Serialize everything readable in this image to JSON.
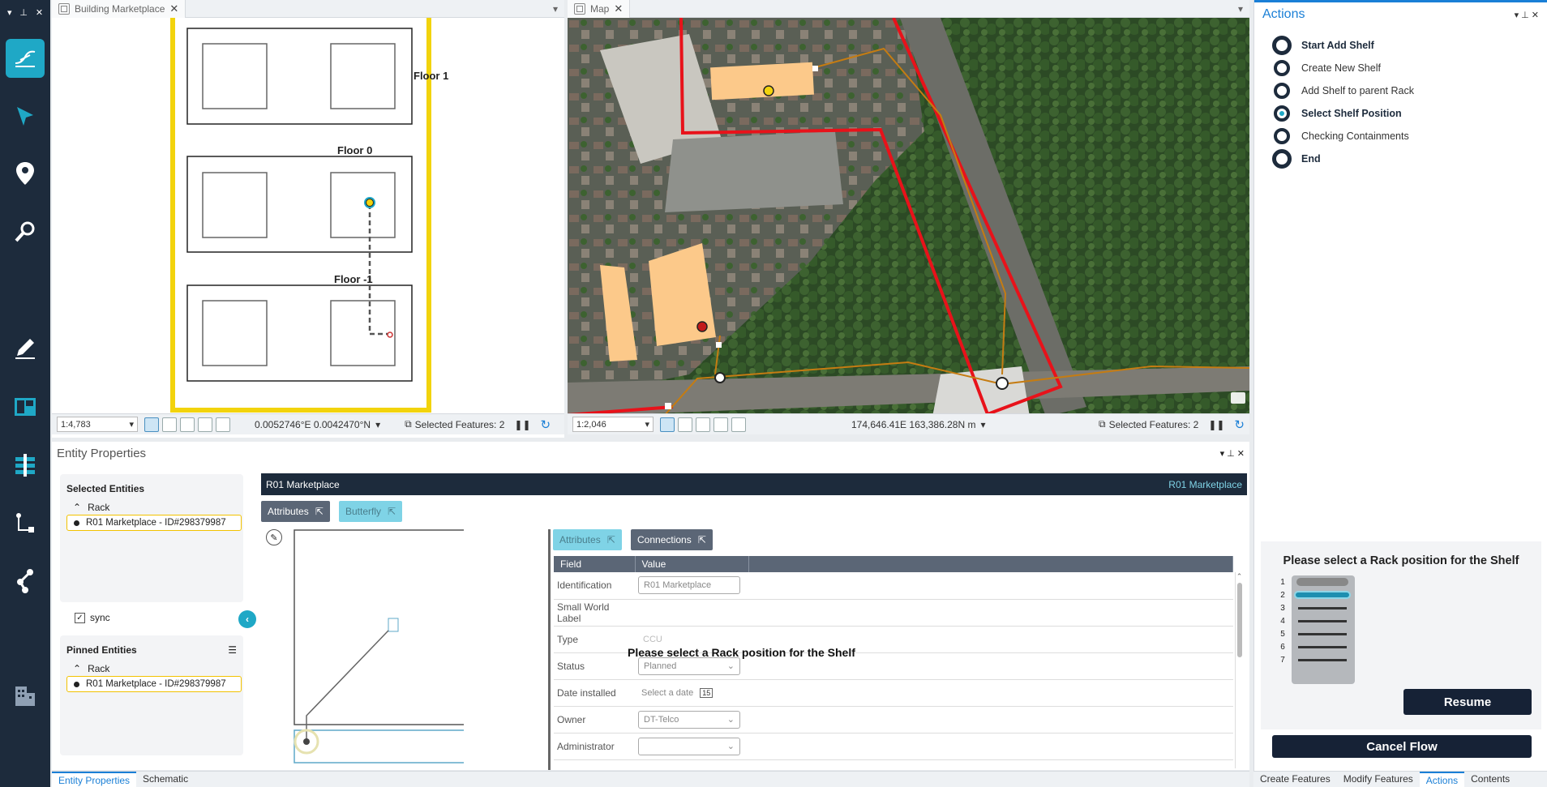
{
  "toolbar": {
    "top_controls": [
      "▾",
      "⊥",
      "✕"
    ],
    "tools": [
      {
        "name": "schematic-icon",
        "active": true
      },
      {
        "name": "cursor-arrow-icon",
        "active": false
      },
      {
        "name": "map-pin-icon",
        "active": false
      },
      {
        "name": "magnifier-icon",
        "active": false
      },
      {
        "name": "pencil-icon",
        "active": false
      },
      {
        "name": "layout-panel-icon",
        "active": false
      },
      {
        "name": "hierarchy-icon",
        "active": false
      },
      {
        "name": "connection-tree-icon",
        "active": false
      },
      {
        "name": "share-nodes-icon",
        "active": false
      },
      {
        "name": "buildings-icon",
        "active": false
      }
    ]
  },
  "building_panel": {
    "tab_title": "Building Marketplace",
    "floors": [
      "Floor 1",
      "Floor 0",
      "Floor -1"
    ],
    "scale": "1:4,783",
    "coords": "0.0052746°E 0.0042470°N",
    "selected": "Selected Features: 2"
  },
  "map_panel": {
    "tab_title": "Map",
    "scale": "1:2,046",
    "coords": "174,646.41E 163,386.28N m",
    "selected": "Selected Features: 2"
  },
  "actions": {
    "title": "Actions",
    "steps": [
      {
        "label": "Start Add Shelf",
        "bold": true
      },
      {
        "label": "Create New Shelf",
        "bold": false
      },
      {
        "label": "Add Shelf to parent Rack",
        "bold": false
      },
      {
        "label": "Select Shelf Position",
        "bold": true
      },
      {
        "label": "Checking Containments",
        "bold": false
      },
      {
        "label": "End",
        "bold": true
      }
    ],
    "prompt": "Please select a Rack position for the Shelf",
    "rack_slots": [
      "1",
      "2",
      "3",
      "4",
      "5",
      "6",
      "7"
    ],
    "resume": "Resume",
    "cancel": "Cancel Flow"
  },
  "entity": {
    "title": "Entity Properties",
    "selected_entities_title": "Selected Entities",
    "group": "Rack",
    "selected_item": "R01 Marketplace - ID#298379987",
    "sync": "sync",
    "pinned_entities_title": "Pinned Entities",
    "pinned_group": "Rack",
    "pinned_item": "R01 Marketplace - ID#298379987",
    "header_left": "R01 Marketplace",
    "header_right": "R01 Marketplace",
    "view_tabs": [
      "Attributes",
      "Butterfly"
    ],
    "detail_tabs": [
      "Attributes",
      "Connections"
    ],
    "columns": [
      "Field",
      "Value"
    ],
    "overlay_message": "Please select a Rack position for the Shelf",
    "rows": [
      {
        "field": "Identification",
        "value": "R01 Marketplace",
        "kind": "text"
      },
      {
        "field": "Small World Label",
        "value": "",
        "kind": "none"
      },
      {
        "field": "Type",
        "value": "CCU",
        "kind": "plain"
      },
      {
        "field": "Status",
        "value": "Planned",
        "kind": "select"
      },
      {
        "field": "Date installed",
        "value": "Select a date",
        "kind": "date"
      },
      {
        "field": "Owner",
        "value": "DT-Telco",
        "kind": "select"
      },
      {
        "field": "Administrator",
        "value": "",
        "kind": "select"
      }
    ],
    "date_badge": "15"
  },
  "bottom_tabs_left": [
    "Entity Properties",
    "Schematic"
  ],
  "bottom_tabs_right": [
    "Create Features",
    "Modify Features",
    "Actions",
    "Contents"
  ]
}
